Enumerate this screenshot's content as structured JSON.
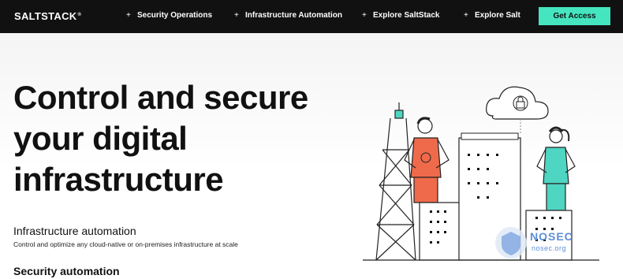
{
  "nav": {
    "logo": "SALTSTACK",
    "logo_tm": "®",
    "items": [
      {
        "label": "Security Operations",
        "icon": "plus-icon"
      },
      {
        "label": "Infrastructure Automation",
        "icon": "plus-icon"
      },
      {
        "label": "Explore SaltStack",
        "icon": "plus-icon"
      },
      {
        "label": "Explore Salt",
        "icon": "plus-icon"
      }
    ],
    "plus": "+",
    "cta_label": "Get Access"
  },
  "hero": {
    "title_line1": "Control and secure",
    "title_line2": "your digital",
    "title_line3": "infrastructure"
  },
  "sections": {
    "infra_title": "Infrastructure automation",
    "infra_desc": "Control and optimize any cloud-native or on-premises infrastructure at scale",
    "security_title": "Security automation"
  },
  "watermark": {
    "name": "NOSEC",
    "domain": "nosec.org"
  },
  "colors": {
    "nav_bg": "#111111",
    "accent": "#45e5c0",
    "man_shirt": "#ef6a4a",
    "woman_shirt": "#4fd6c2"
  }
}
